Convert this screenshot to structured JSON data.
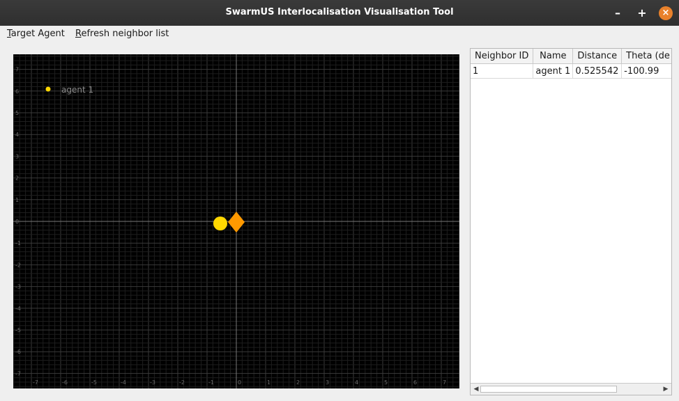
{
  "window": {
    "title": "SwarmUS Interlocalisation Visualisation Tool"
  },
  "controls": {
    "minimize": "–",
    "maximize": "+",
    "close": "×"
  },
  "menu": {
    "items": [
      {
        "mnemonic": "T",
        "rest": "arget Agent"
      },
      {
        "mnemonic": "R",
        "rest": "efresh neighbor list"
      }
    ]
  },
  "plot": {
    "x_ticks": [
      "-7",
      "-6",
      "-5",
      "-4",
      "-3",
      "-2",
      "-1",
      "0",
      "1",
      "2",
      "3",
      "4",
      "5",
      "6",
      "7"
    ],
    "y_ticks": [
      "7",
      "6",
      "5",
      "4",
      "3",
      "2",
      "1",
      "0",
      "-1",
      "-2",
      "-3",
      "-4",
      "-5",
      "-6",
      "-7"
    ],
    "legend_label": "agent 1",
    "colors": {
      "agent": "#ffd700",
      "self": "#ff9900",
      "background": "#000000"
    }
  },
  "neighbors": {
    "headers": [
      "Neighbor ID",
      "Name",
      "Distance",
      "Theta (de"
    ],
    "rows": [
      {
        "id": "1",
        "name": "agent 1",
        "distance": "0.525542",
        "theta": "-100.99"
      }
    ]
  }
}
